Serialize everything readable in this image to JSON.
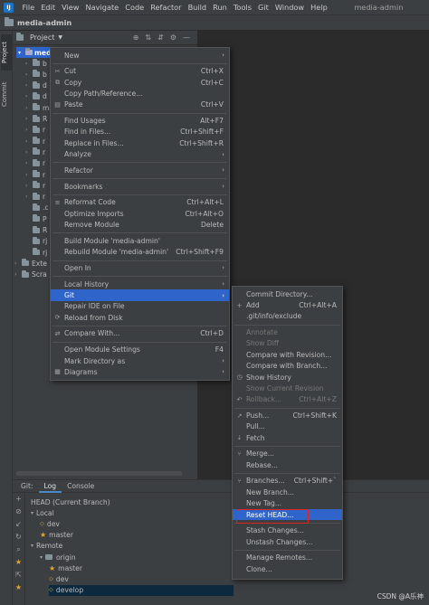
{
  "menubar": {
    "items": [
      "File",
      "Edit",
      "View",
      "Navigate",
      "Code",
      "Refactor",
      "Build",
      "Run",
      "Tools",
      "Git",
      "Window",
      "Help"
    ],
    "window_title": "media-admin"
  },
  "breadcrumb": "media-admin",
  "side_tabs": [
    "Project",
    "Commit"
  ],
  "project_panel": {
    "title": "Project",
    "root": "medi",
    "rows": [
      {
        "t": "b",
        "lv": 1
      },
      {
        "t": "b",
        "lv": 1
      },
      {
        "t": "d",
        "lv": 1
      },
      {
        "t": "d",
        "lv": 1
      },
      {
        "t": "m",
        "lv": 1
      },
      {
        "t": "R",
        "lv": 1
      },
      {
        "t": "r",
        "lv": 1
      },
      {
        "t": "r",
        "lv": 1
      },
      {
        "t": "r",
        "lv": 1
      },
      {
        "t": "r",
        "lv": 1
      },
      {
        "t": "r",
        "lv": 1
      },
      {
        "t": "r",
        "lv": 1
      },
      {
        "t": "r",
        "lv": 1
      },
      {
        "t": ".c",
        "lv": 1
      },
      {
        "t": "P",
        "lv": 1
      },
      {
        "t": "R",
        "lv": 1
      },
      {
        "t": "rj",
        "lv": 1
      },
      {
        "t": "rj",
        "lv": 1
      },
      {
        "t": "Exte",
        "lv": 0
      },
      {
        "t": "Scra",
        "lv": 0
      }
    ]
  },
  "bottom": {
    "tabs": [
      "Git:",
      "Log",
      "Console"
    ],
    "tree": [
      {
        "label": "HEAD (Current Branch)",
        "lv": 1,
        "kind": "text"
      },
      {
        "label": "Local",
        "lv": 1,
        "kind": "group"
      },
      {
        "label": "dev",
        "lv": 2,
        "kind": "tag"
      },
      {
        "label": "master",
        "lv": 2,
        "kind": "star"
      },
      {
        "label": "Remote",
        "lv": 1,
        "kind": "group"
      },
      {
        "label": "origin",
        "lv": 2,
        "kind": "folder"
      },
      {
        "label": "master",
        "lv": 3,
        "kind": "star"
      },
      {
        "label": "dev",
        "lv": 3,
        "kind": "tag"
      },
      {
        "label": "develop",
        "lv": 3,
        "kind": "tag"
      }
    ]
  },
  "context_menu": [
    {
      "label": "New",
      "icon": "",
      "shortcut": "",
      "sub": true
    },
    {
      "sep": true
    },
    {
      "label": "Cut",
      "icon": "✂",
      "shortcut": "Ctrl+X"
    },
    {
      "label": "Copy",
      "icon": "⧉",
      "shortcut": "Ctrl+C"
    },
    {
      "label": "Copy Path/Reference...",
      "icon": "",
      "shortcut": ""
    },
    {
      "label": "Paste",
      "icon": "▤",
      "shortcut": "Ctrl+V"
    },
    {
      "sep": true
    },
    {
      "label": "Find Usages",
      "icon": "",
      "shortcut": "Alt+F7"
    },
    {
      "label": "Find in Files...",
      "icon": "",
      "shortcut": "Ctrl+Shift+F"
    },
    {
      "label": "Replace in Files...",
      "icon": "",
      "shortcut": "Ctrl+Shift+R"
    },
    {
      "label": "Analyze",
      "icon": "",
      "shortcut": "",
      "sub": true
    },
    {
      "sep": true
    },
    {
      "label": "Refactor",
      "icon": "",
      "shortcut": "",
      "sub": true
    },
    {
      "sep": true
    },
    {
      "label": "Bookmarks",
      "icon": "",
      "shortcut": "",
      "sub": true
    },
    {
      "sep": true
    },
    {
      "label": "Reformat Code",
      "icon": "≡",
      "shortcut": "Ctrl+Alt+L"
    },
    {
      "label": "Optimize Imports",
      "icon": "",
      "shortcut": "Ctrl+Alt+O"
    },
    {
      "label": "Remove Module",
      "icon": "",
      "shortcut": "Delete"
    },
    {
      "sep": true
    },
    {
      "label": "Build Module 'media-admin'",
      "icon": "",
      "shortcut": ""
    },
    {
      "label": "Rebuild Module 'media-admin'",
      "icon": "",
      "shortcut": "Ctrl+Shift+F9"
    },
    {
      "sep": true
    },
    {
      "label": "Open In",
      "icon": "",
      "shortcut": "",
      "sub": true
    },
    {
      "sep": true
    },
    {
      "label": "Local History",
      "icon": "",
      "shortcut": "",
      "sub": true
    },
    {
      "label": "Git",
      "icon": "",
      "shortcut": "",
      "sub": true,
      "hl": true
    },
    {
      "label": "Repair IDE on File",
      "icon": "",
      "shortcut": ""
    },
    {
      "label": "Reload from Disk",
      "icon": "⟳",
      "shortcut": ""
    },
    {
      "sep": true
    },
    {
      "label": "Compare With...",
      "icon": "⇄",
      "shortcut": "Ctrl+D"
    },
    {
      "sep": true
    },
    {
      "label": "Open Module Settings",
      "icon": "",
      "shortcut": "F4"
    },
    {
      "label": "Mark Directory as",
      "icon": "",
      "shortcut": "",
      "sub": true
    },
    {
      "label": "Diagrams",
      "icon": "▦",
      "shortcut": "",
      "sub": true
    }
  ],
  "git_menu": [
    {
      "label": "Commit Directory...",
      "icon": "",
      "shortcut": ""
    },
    {
      "label": "Add",
      "icon": "+",
      "shortcut": "Ctrl+Alt+A"
    },
    {
      "label": ".git/info/exclude",
      "icon": "",
      "shortcut": ""
    },
    {
      "sep": true
    },
    {
      "label": "Annotate",
      "icon": "",
      "shortcut": "",
      "dis": true
    },
    {
      "label": "Show Diff",
      "icon": "",
      "shortcut": "",
      "dis": true
    },
    {
      "label": "Compare with Revision...",
      "icon": "",
      "shortcut": ""
    },
    {
      "label": "Compare with Branch...",
      "icon": "",
      "shortcut": ""
    },
    {
      "label": "Show History",
      "icon": "◷",
      "shortcut": ""
    },
    {
      "label": "Show Current Revision",
      "icon": "",
      "shortcut": "",
      "dis": true
    },
    {
      "label": "Rollback...",
      "icon": "↶",
      "shortcut": "Ctrl+Alt+Z",
      "dis": true
    },
    {
      "sep": true
    },
    {
      "label": "Push...",
      "icon": "↗",
      "shortcut": "Ctrl+Shift+K"
    },
    {
      "label": "Pull...",
      "icon": "",
      "shortcut": ""
    },
    {
      "label": "Fetch",
      "icon": "⇣",
      "shortcut": ""
    },
    {
      "sep": true
    },
    {
      "label": "Merge...",
      "icon": "⑂",
      "shortcut": ""
    },
    {
      "label": "Rebase...",
      "icon": "",
      "shortcut": ""
    },
    {
      "sep": true
    },
    {
      "label": "Branches...",
      "icon": "⑂",
      "shortcut": "Ctrl+Shift+`"
    },
    {
      "label": "New Branch...",
      "icon": "",
      "shortcut": ""
    },
    {
      "label": "New Tag...",
      "icon": "",
      "shortcut": ""
    },
    {
      "label": "Reset HEAD...",
      "icon": "",
      "shortcut": "",
      "hl": true
    },
    {
      "sep": true
    },
    {
      "label": "Stash Changes...",
      "icon": "",
      "shortcut": ""
    },
    {
      "label": "Unstash Changes...",
      "icon": "",
      "shortcut": ""
    },
    {
      "sep": true
    },
    {
      "label": "Manage Remotes...",
      "icon": "",
      "shortcut": ""
    },
    {
      "label": "Clone...",
      "icon": "",
      "shortcut": ""
    }
  ],
  "watermark": "CSDN @A乐神",
  "colors": {
    "selection": "#2f65ca",
    "highlight_box": "#e02424"
  }
}
